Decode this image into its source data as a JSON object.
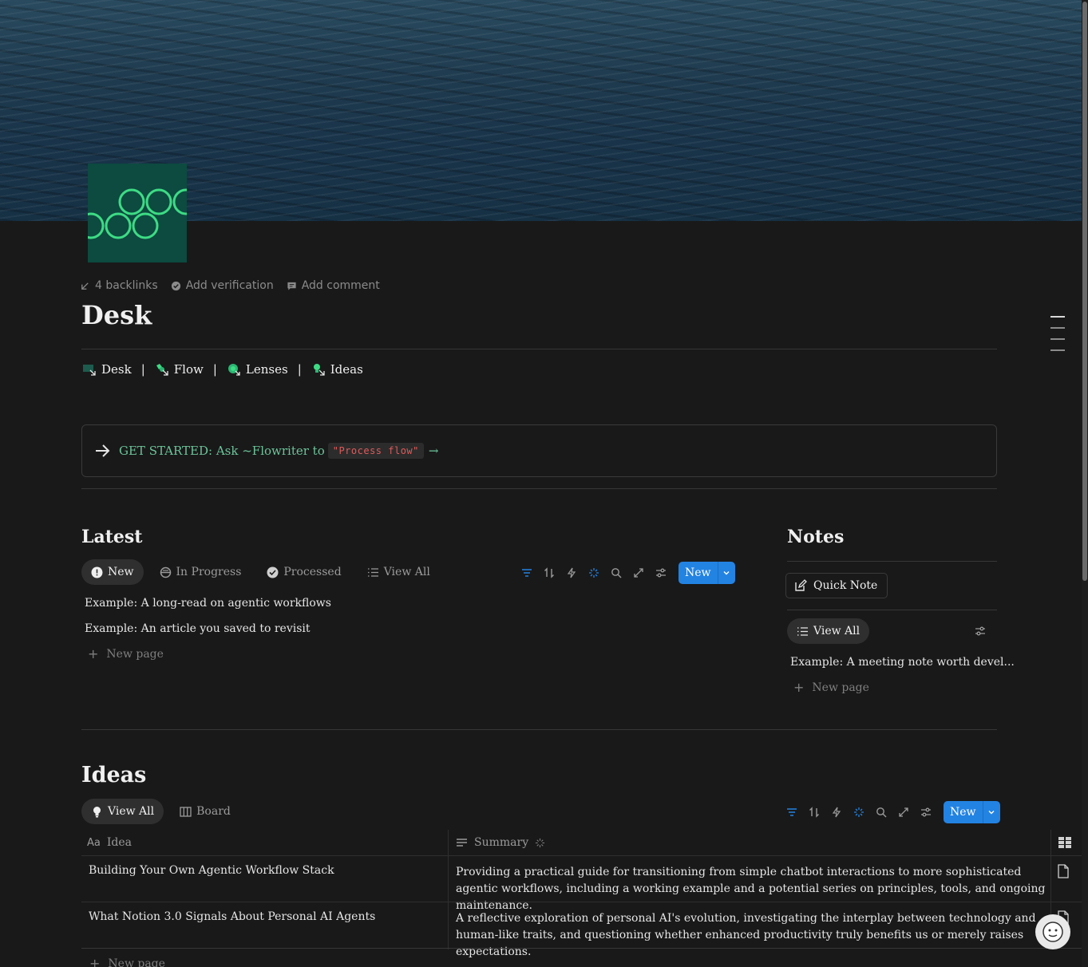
{
  "page": {
    "title": "Desk",
    "meta": {
      "backlinks": "4 backlinks",
      "verification": "Add verification",
      "comment": "Add comment"
    }
  },
  "nav": {
    "items": [
      {
        "label": "Desk",
        "icon": "desk-icon"
      },
      {
        "label": "Flow",
        "icon": "flow-icon"
      },
      {
        "label": "Lenses",
        "icon": "lenses-icon"
      },
      {
        "label": "Ideas",
        "icon": "ideas-icon"
      }
    ],
    "separator": "|"
  },
  "callout": {
    "text": "GET STARTED: Ask ~Flowriter to",
    "code": "\"Process flow\"",
    "tail": "→"
  },
  "latest": {
    "heading": "Latest",
    "tabs": [
      {
        "label": "New",
        "icon": "alert-circle-icon",
        "active": true
      },
      {
        "label": "In Progress",
        "icon": "in-progress-icon",
        "active": false
      },
      {
        "label": "Processed",
        "icon": "check-circle-icon",
        "active": false
      },
      {
        "label": "View All",
        "icon": "list-icon",
        "active": false
      }
    ],
    "new_button": "New",
    "rows": [
      "Example: A long-read on agentic workflows",
      "Example: An article you saved to revisit"
    ],
    "new_page": "New page"
  },
  "notes": {
    "heading": "Notes",
    "quick_note": "Quick Note",
    "view_all": "View All",
    "rows": [
      "Example: A meeting note worth devel..."
    ],
    "new_page": "New page"
  },
  "ideas": {
    "heading": "Ideas",
    "tabs": [
      {
        "label": "View All",
        "icon": "lightbulb-icon",
        "active": true
      },
      {
        "label": "Board",
        "icon": "board-icon",
        "active": false
      }
    ],
    "new_button": "New",
    "columns": {
      "idea": "Idea",
      "summary": "Summary"
    },
    "column_prefix": "Aa",
    "rows": [
      {
        "idea": "Building Your Own Agentic Workflow Stack",
        "summary": "Providing a practical guide for transitioning from simple chatbot interactions to more sophisticated agentic workflows, including a working example and a potential series on principles, tools, and ongoing maintenance."
      },
      {
        "idea": "What Notion 3.0 Signals About Personal AI Agents",
        "summary": "A reflective exploration of personal AI's evolution, investigating the interplay between technology and human-like traits, and questioning whether enhanced productivity truly benefits us or merely raises expectations."
      }
    ],
    "new_page": "New page"
  },
  "colors": {
    "background": "#191919",
    "accent_blue": "#2383e2",
    "callout_green": "#6cc49a",
    "code_red": "#e05a5a",
    "icon_teal": "#0d4a40",
    "icon_rings": "#3ddc84"
  }
}
